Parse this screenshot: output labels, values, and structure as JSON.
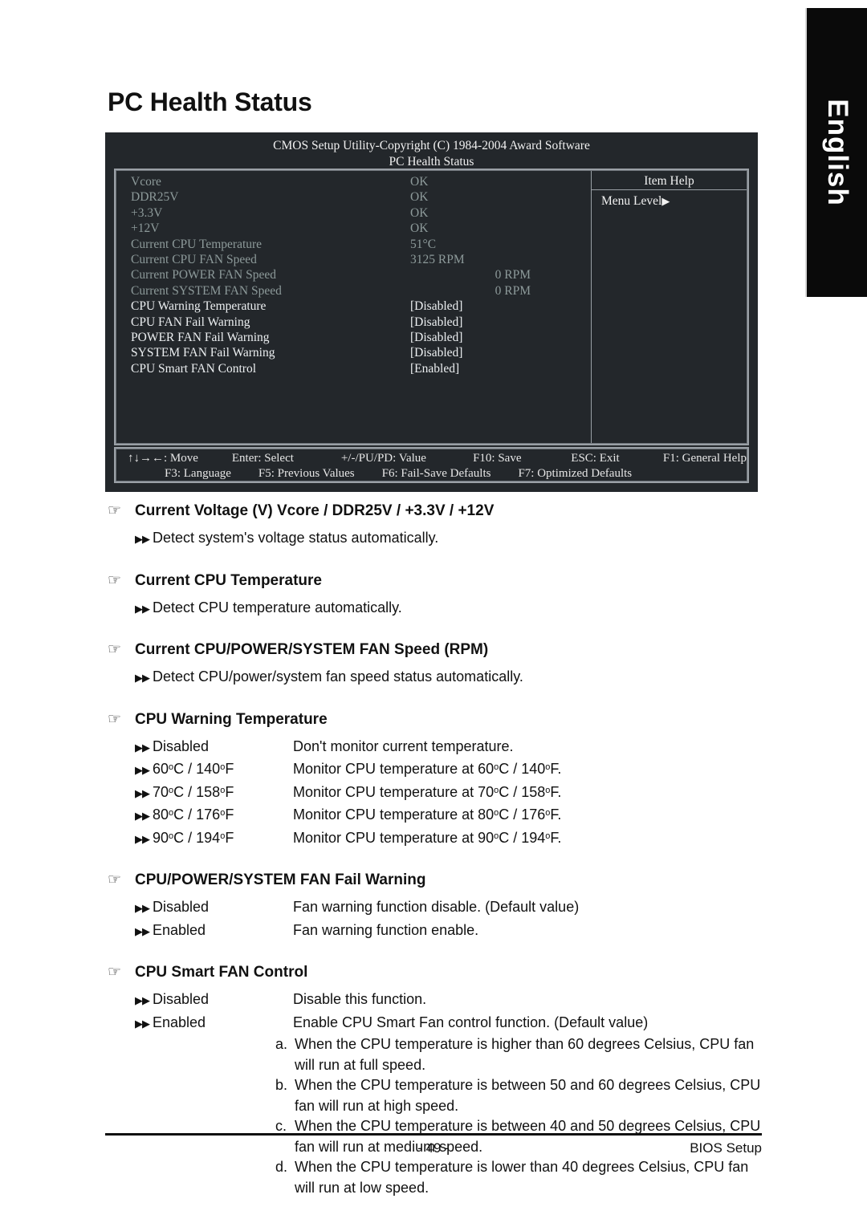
{
  "page": {
    "title": "PC Health Status",
    "language_tab": "English",
    "page_number": "- 49 -",
    "footer_right": "BIOS Setup"
  },
  "bios": {
    "title": "CMOS Setup Utility-Copyright (C) 1984-2004 Award Software",
    "subtitle": "PC Health Status",
    "item_help_title": "Item Help",
    "menu_level": "Menu Level",
    "menu_level_arrow": "▶",
    "rows": [
      {
        "name": "Vcore",
        "value": "OK",
        "state": "dim",
        "align": "left"
      },
      {
        "name": "DDR25V",
        "value": "OK",
        "state": "dim",
        "align": "left"
      },
      {
        "name": "+3.3V",
        "value": "OK",
        "state": "dim",
        "align": "left"
      },
      {
        "name": "+12V",
        "value": "OK",
        "state": "dim",
        "align": "left"
      },
      {
        "name": "Current CPU Temperature",
        "value": "51°C",
        "state": "dim",
        "align": "left"
      },
      {
        "name": "Current CPU FAN Speed",
        "value": "3125 RPM",
        "state": "dim",
        "align": "left"
      },
      {
        "name": "Current POWER FAN Speed",
        "value": "0 RPM",
        "state": "dim",
        "align": "right"
      },
      {
        "name": "Current SYSTEM FAN Speed",
        "value": "0 RPM",
        "state": "dim",
        "align": "right"
      },
      {
        "name": "CPU Warning Temperature",
        "value": "[Disabled]",
        "state": "lit",
        "align": "left"
      },
      {
        "name": "CPU FAN Fail Warning",
        "value": "[Disabled]",
        "state": "lit",
        "align": "left"
      },
      {
        "name": "POWER FAN Fail Warning",
        "value": "[Disabled]",
        "state": "lit",
        "align": "left"
      },
      {
        "name": "SYSTEM FAN Fail Warning",
        "value": "[Disabled]",
        "state": "lit",
        "align": "left"
      },
      {
        "name": "CPU Smart FAN Control",
        "value": "[Enabled]",
        "state": "lit",
        "align": "left"
      }
    ],
    "keys_row1": [
      "↑↓→←: Move",
      "Enter: Select",
      "+/-/PU/PD: Value",
      "F10: Save",
      "ESC: Exit",
      "F1: General Help"
    ],
    "keys_row2": [
      "F3: Language",
      "F5: Previous Values",
      "F6: Fail-Save Defaults",
      "F7: Optimized Defaults"
    ]
  },
  "doc": {
    "hand_glyph": "☞",
    "bullet_glyph": "▶▶",
    "sections": [
      {
        "heading": "Current Voltage (V) Vcore / DDR25V / +3.3V / +12V",
        "options": [
          {
            "plain": "Detect system's voltage status automatically."
          }
        ]
      },
      {
        "heading": "Current CPU Temperature",
        "options": [
          {
            "plain": "Detect CPU temperature automatically."
          }
        ]
      },
      {
        "heading": "Current CPU/POWER/SYSTEM FAN Speed (RPM)",
        "options": [
          {
            "plain": "Detect CPU/power/system fan speed status automatically."
          }
        ]
      },
      {
        "heading": "CPU Warning Temperature",
        "options": [
          {
            "label": "Disabled",
            "desc": "Don't monitor current temperature."
          },
          {
            "label_html": "60<sup class=\"deg\">o</sup>C / 140<sup class=\"deg\">o</sup>F",
            "desc_html": "Monitor CPU temperature at 60<sup class=\"deg\">o</sup>C / 140<sup class=\"deg\">o</sup>F."
          },
          {
            "label_html": "70<sup class=\"deg\">o</sup>C / 158<sup class=\"deg\">o</sup>F",
            "desc_html": "Monitor CPU temperature at 70<sup class=\"deg\">o</sup>C / 158<sup class=\"deg\">o</sup>F."
          },
          {
            "label_html": "80<sup class=\"deg\">o</sup>C / 176<sup class=\"deg\">o</sup>F",
            "desc_html": "Monitor CPU temperature at 80<sup class=\"deg\">o</sup>C / 176<sup class=\"deg\">o</sup>F."
          },
          {
            "label_html": "90<sup class=\"deg\">o</sup>C / 194<sup class=\"deg\">o</sup>F",
            "desc_html": "Monitor CPU temperature at 90<sup class=\"deg\">o</sup>C / 194<sup class=\"deg\">o</sup>F."
          }
        ]
      },
      {
        "heading": "CPU/POWER/SYSTEM FAN Fail Warning",
        "options": [
          {
            "label": "Disabled",
            "desc": "Fan warning function disable. (Default value)"
          },
          {
            "label": "Enabled",
            "desc": "Fan warning function enable."
          }
        ]
      },
      {
        "heading": "CPU Smart FAN Control",
        "options": [
          {
            "label": "Disabled",
            "desc": "Disable this function."
          },
          {
            "label": "Enabled",
            "desc": "Enable CPU Smart Fan control function. (Default value)"
          }
        ],
        "sub_items": [
          {
            "letter": "a.",
            "line1": "When the CPU temperature is higher than 60 degrees Celsius, CPU fan",
            "line2": "will run at full speed."
          },
          {
            "letter": "b.",
            "line1": "When the CPU temperature is between 50 and 60 degrees Celsius, CPU",
            "line2": "fan will run at high speed."
          },
          {
            "letter": "c.",
            "line1": "When the CPU temperature is between 40 and 50 degrees Celsius, CPU",
            "line2": "fan will run at medium speed."
          },
          {
            "letter": "d.",
            "line1": "When the CPU temperature is lower than 40 degrees Celsius, CPU fan",
            "line2": "will run at low speed."
          }
        ]
      }
    ]
  }
}
